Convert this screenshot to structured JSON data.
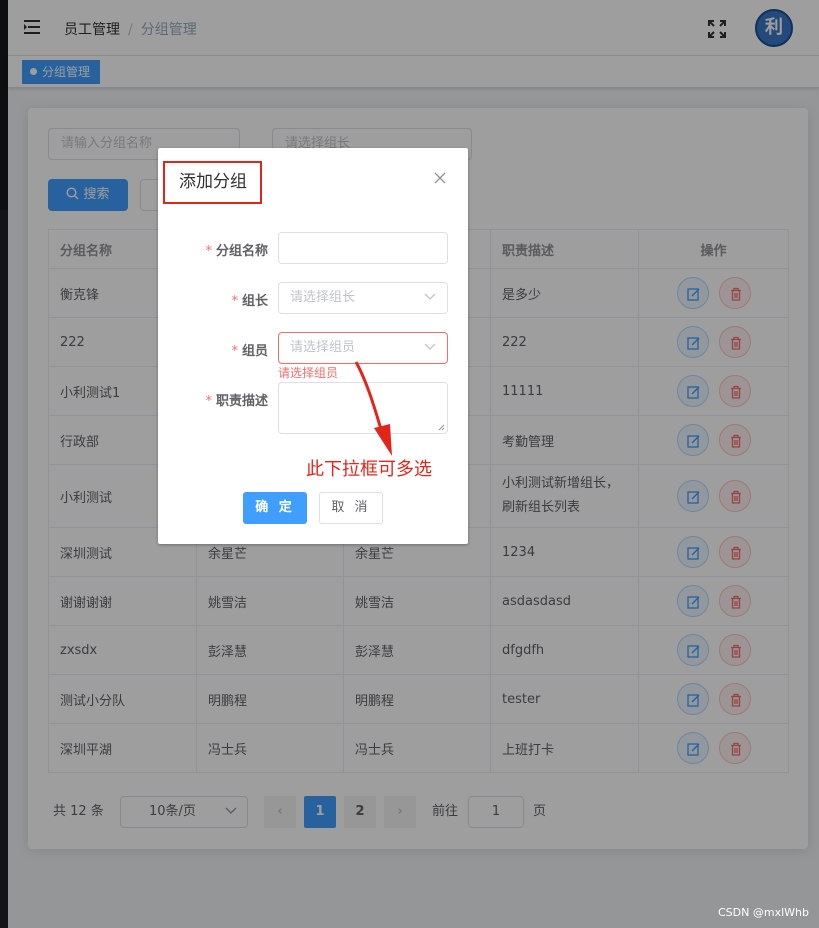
{
  "header": {
    "breadcrumb": [
      "员工管理",
      "分组管理"
    ],
    "breadcrumb_separator": "/",
    "avatar_text": "利"
  },
  "tags_view": {
    "active_tag": "分组管理"
  },
  "filters": {
    "group_name_placeholder": "请输入分组名称",
    "leader_placeholder": "请选择组长",
    "search_label": "搜索"
  },
  "table": {
    "columns": [
      "分组名称",
      "",
      "",
      "职责描述",
      "操作"
    ],
    "rows": [
      {
        "name": "衡克锋",
        "leader": "",
        "members": "",
        "desc": "是多少"
      },
      {
        "name": "222",
        "leader": "",
        "members": "",
        "desc": "222"
      },
      {
        "name": "小利测试1",
        "leader": "",
        "members": "",
        "desc": "11111"
      },
      {
        "name": "行政部",
        "leader": "",
        "members": "",
        "desc": "考勤管理"
      },
      {
        "name": "小利测试",
        "leader": "",
        "members": "",
        "desc": "小利测试新增组长，刷新组长列表"
      },
      {
        "name": "深圳测试",
        "leader": "余星芒",
        "members": "余星芒",
        "desc": "1234"
      },
      {
        "name": "谢谢谢谢",
        "leader": "姚雪洁",
        "members": "姚雪洁",
        "desc": "asdasdasd"
      },
      {
        "name": "zxsdx",
        "leader": "彭泽慧",
        "members": "彭泽慧",
        "desc": "dfgdfh"
      },
      {
        "name": "测试小分队",
        "leader": "明鹏程",
        "members": "明鹏程",
        "desc": "tester"
      },
      {
        "name": "深圳平湖",
        "leader": "冯士兵",
        "members": "冯士兵",
        "desc": "上班打卡"
      }
    ]
  },
  "pagination": {
    "total_text": "共 12 条",
    "page_size": "10条/页",
    "pages": [
      "1",
      "2"
    ],
    "current_page": "1",
    "goto_label": "前往",
    "goto_value": "1",
    "page_suffix": "页"
  },
  "dialog": {
    "title": "添加分组",
    "fields": {
      "name_label": "分组名称",
      "leader_label": "组长",
      "leader_placeholder": "请选择组长",
      "members_label": "组员",
      "members_placeholder": "请选择组员",
      "members_error": "请选择组员",
      "desc_label": "职责描述"
    },
    "required_mark": "*",
    "ok_label": "确 定",
    "cancel_label": "取 消"
  },
  "annotation": {
    "text": "此下拉框可多选",
    "color": "#e1251b"
  },
  "watermark": "CSDN @mxlWhb",
  "colors": {
    "primary": "#409eff",
    "danger": "#f56c6c",
    "annotation": "#e1251b"
  }
}
